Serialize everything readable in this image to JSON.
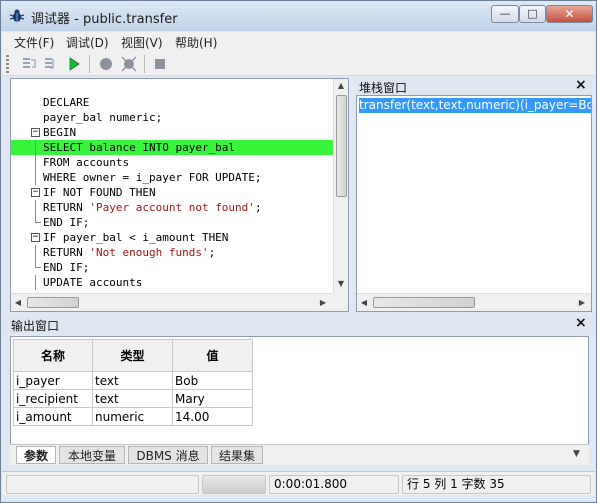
{
  "window": {
    "title": "调试器 - public.transfer"
  },
  "menu": [
    "文件(F)",
    "调试(D)",
    "视图(V)",
    "帮助(H)"
  ],
  "toolbar": {
    "icons": [
      "step-into-icon",
      "step-over-icon",
      "run-icon",
      "breakpoint-icon",
      "clear-breakpoints-icon",
      "stop-icon"
    ]
  },
  "code": {
    "lines": [
      {
        "text": "DECLARE",
        "fold": "",
        "hl": false
      },
      {
        "text": "payer_bal numeric;",
        "fold": "",
        "hl": false
      },
      {
        "text": "BEGIN",
        "fold": "box",
        "hl": false
      },
      {
        "text": "SELECT balance INTO payer_bal",
        "fold": "line",
        "hl": true
      },
      {
        "text": "FROM accounts",
        "fold": "line",
        "hl": false
      },
      {
        "text": "WHERE owner = i_payer FOR UPDATE;",
        "fold": "line",
        "hl": false
      },
      {
        "text": "IF NOT FOUND THEN",
        "fold": "box",
        "hl": false
      },
      {
        "text": "RETURN 'Payer account not found';",
        "fold": "line",
        "hl": false
      },
      {
        "text": "END IF;",
        "fold": "end",
        "hl": false
      },
      {
        "text": "IF payer_bal < i_amount THEN",
        "fold": "box",
        "hl": false
      },
      {
        "text": "RETURN 'Not enough funds';",
        "fold": "line",
        "hl": false
      },
      {
        "text": "END IF;",
        "fold": "end",
        "hl": false
      },
      {
        "text": "UPDATE accounts",
        "fold": "line",
        "hl": false
      }
    ]
  },
  "stack": {
    "title": "堆栈窗口",
    "close": "×",
    "frames": [
      "transfer(text,text,numeric)(i_payer=Bob,"
    ]
  },
  "output": {
    "title": "输出窗口",
    "close": "×",
    "columns": [
      "名称",
      "类型",
      "值"
    ],
    "rows": [
      [
        "i_payer",
        "text",
        "Bob"
      ],
      [
        "i_recipient",
        "text",
        "Mary"
      ],
      [
        "i_amount",
        "numeric",
        "14.00"
      ]
    ],
    "tabs": [
      "参数",
      "本地变量",
      "DBMS 消息",
      "结果集"
    ]
  },
  "status": {
    "elapsed": "0:00:01.800",
    "position": "行 5 列 1 字数 35"
  }
}
